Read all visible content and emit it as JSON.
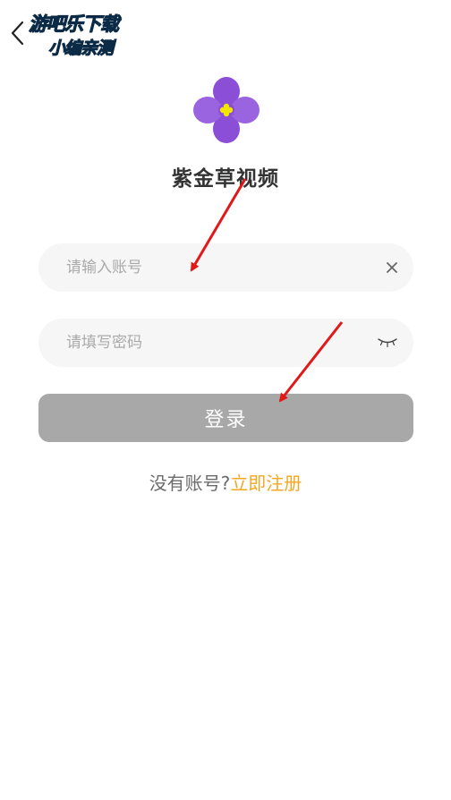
{
  "app": {
    "title": "紫金草视频"
  },
  "login": {
    "account_placeholder": "请输入账号",
    "password_placeholder": "请填写密码",
    "submit_label": "登录",
    "register_prompt": "没有账号?",
    "register_link": "立即注册"
  },
  "icons": {
    "back": "chevron-left-icon",
    "clear": "close-icon",
    "password_toggle": "eye-closed-icon",
    "logo": "purple-flower-logo"
  },
  "watermark": {
    "line1": "游吧乐下载",
    "line2": "小编亲测"
  },
  "colors": {
    "logo_petal": "#8a4fd6",
    "logo_center": "#f3e600",
    "button_bg": "#a8a8a8",
    "link": "#f5a623",
    "input_bg": "#f6f6f6",
    "arrow": "#e11818",
    "watermark_fill": "#2fc6f0"
  }
}
